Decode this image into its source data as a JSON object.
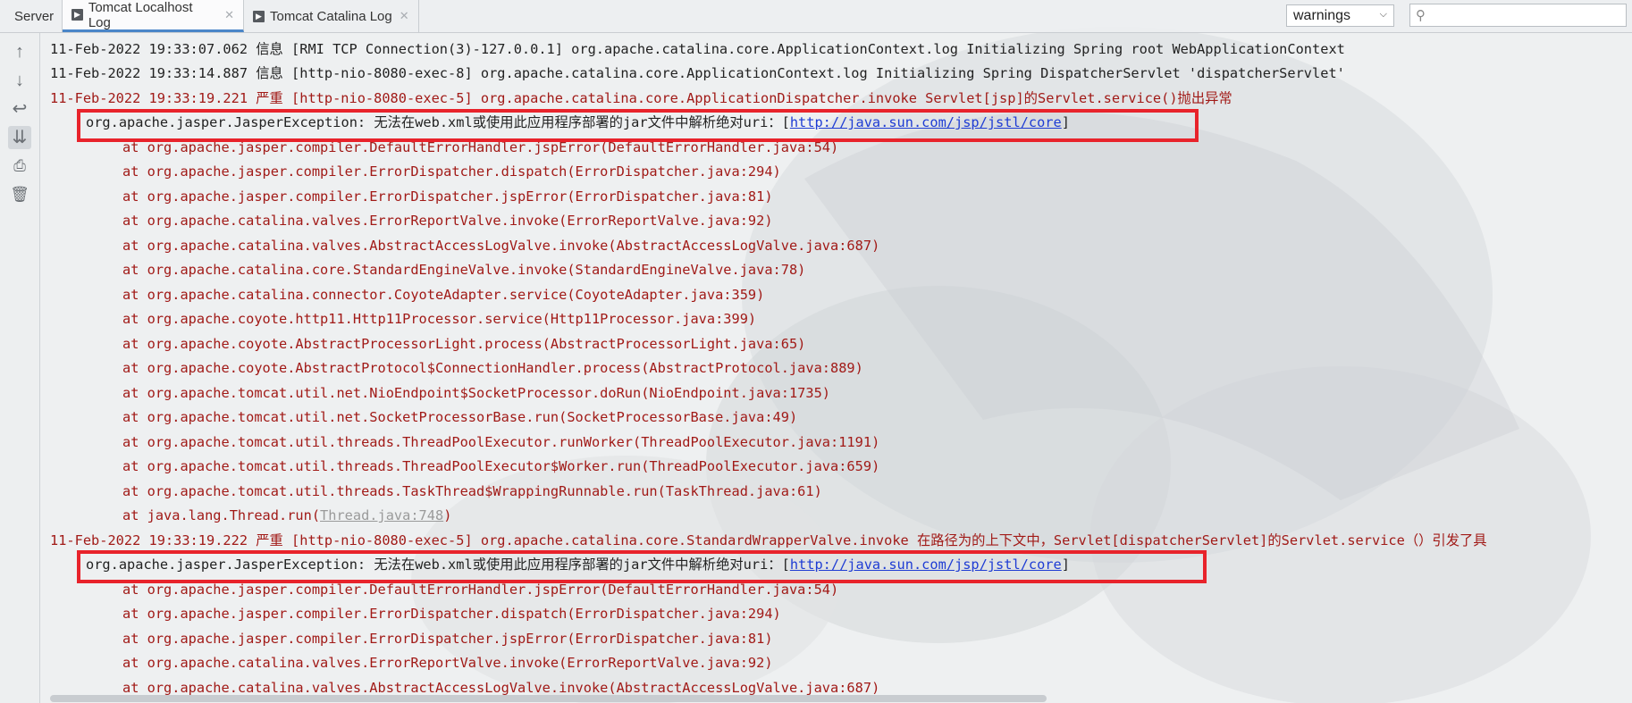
{
  "tabs": [
    {
      "label": "Server"
    },
    {
      "label": "Tomcat Localhost Log",
      "active": true
    },
    {
      "label": "Tomcat Catalina Log"
    }
  ],
  "filter": {
    "selected": "warnings"
  },
  "search": {
    "placeholder": "",
    "value": ""
  },
  "toolbar_icons": [
    "arrow-up-icon",
    "arrow-down-icon",
    "soft-wrap-icon",
    "scroll-to-end-icon",
    "print-icon",
    "trash-icon"
  ],
  "colors": {
    "error_text": "#a11a17",
    "link": "#1e3cd4",
    "highlight_box": "#e8232b"
  },
  "log": {
    "line1": "11-Feb-2022 19:33:07.062 信息 [RMI TCP Connection(3)-127.0.0.1] org.apache.catalina.core.ApplicationContext.log Initializing Spring root WebApplicationContext",
    "line2": "11-Feb-2022 19:33:14.887 信息 [http-nio-8080-exec-8] org.apache.catalina.core.ApplicationContext.log Initializing Spring DispatcherServlet 'dispatcherServlet'",
    "line3": "11-Feb-2022 19:33:19.221 严重 [http-nio-8080-exec-5] org.apache.catalina.core.ApplicationDispatcher.invoke Servlet[jsp]的Servlet.service()抛出异常",
    "exception1": {
      "prefix": "org.apache.jasper.JasperException: 无法在web.xml或使用此应用程序部署的jar文件中解析绝对uri：[",
      "link": "http://java.sun.com/jsp/jstl/core",
      "suffix": "]"
    },
    "trace1": [
      "at org.apache.jasper.compiler.DefaultErrorHandler.jspError(DefaultErrorHandler.java:54)",
      "at org.apache.jasper.compiler.ErrorDispatcher.dispatch(ErrorDispatcher.java:294)",
      "at org.apache.jasper.compiler.ErrorDispatcher.jspError(ErrorDispatcher.java:81)",
      "at org.apache.catalina.valves.ErrorReportValve.invoke(ErrorReportValve.java:92)",
      "at org.apache.catalina.valves.AbstractAccessLogValve.invoke(AbstractAccessLogValve.java:687)",
      "at org.apache.catalina.core.StandardEngineValve.invoke(StandardEngineValve.java:78)",
      "at org.apache.catalina.connector.CoyoteAdapter.service(CoyoteAdapter.java:359)",
      "at org.apache.coyote.http11.Http11Processor.service(Http11Processor.java:399)",
      "at org.apache.coyote.AbstractProcessorLight.process(AbstractProcessorLight.java:65)",
      "at org.apache.coyote.AbstractProtocol$ConnectionHandler.process(AbstractProtocol.java:889)",
      "at org.apache.tomcat.util.net.NioEndpoint$SocketProcessor.doRun(NioEndpoint.java:1735)",
      "at org.apache.tomcat.util.net.SocketProcessorBase.run(SocketProcessorBase.java:49)",
      "at org.apache.tomcat.util.threads.ThreadPoolExecutor.runWorker(ThreadPoolExecutor.java:1191)",
      "at org.apache.tomcat.util.threads.ThreadPoolExecutor$Worker.run(ThreadPoolExecutor.java:659)",
      "at org.apache.tomcat.util.threads.TaskThread$WrappingRunnable.run(TaskThread.java:61)"
    ],
    "thread_run": {
      "prefix": "at java.lang.Thread.run(",
      "link": "Thread.java:748",
      "suffix": ")"
    },
    "line4": "11-Feb-2022 19:33:19.222 严重 [http-nio-8080-exec-5] org.apache.catalina.core.StandardWrapperValve.invoke 在路径为的上下文中，Servlet[dispatcherServlet]的Servlet.service（）引发了具",
    "exception2": {
      "prefix": "org.apache.jasper.JasperException: 无法在web.xml或使用此应用程序部署的jar文件中解析绝对uri：[",
      "link": "http://java.sun.com/jsp/jstl/core",
      "suffix": "]"
    },
    "trace2": [
      "at org.apache.jasper.compiler.DefaultErrorHandler.jspError(DefaultErrorHandler.java:54)",
      "at org.apache.jasper.compiler.ErrorDispatcher.dispatch(ErrorDispatcher.java:294)",
      "at org.apache.jasper.compiler.ErrorDispatcher.jspError(ErrorDispatcher.java:81)",
      "at org.apache.catalina.valves.ErrorReportValve.invoke(ErrorReportValve.java:92)",
      "at org.apache.catalina.valves.AbstractAccessLogValve.invoke(AbstractAccessLogValve.java:687)"
    ]
  }
}
